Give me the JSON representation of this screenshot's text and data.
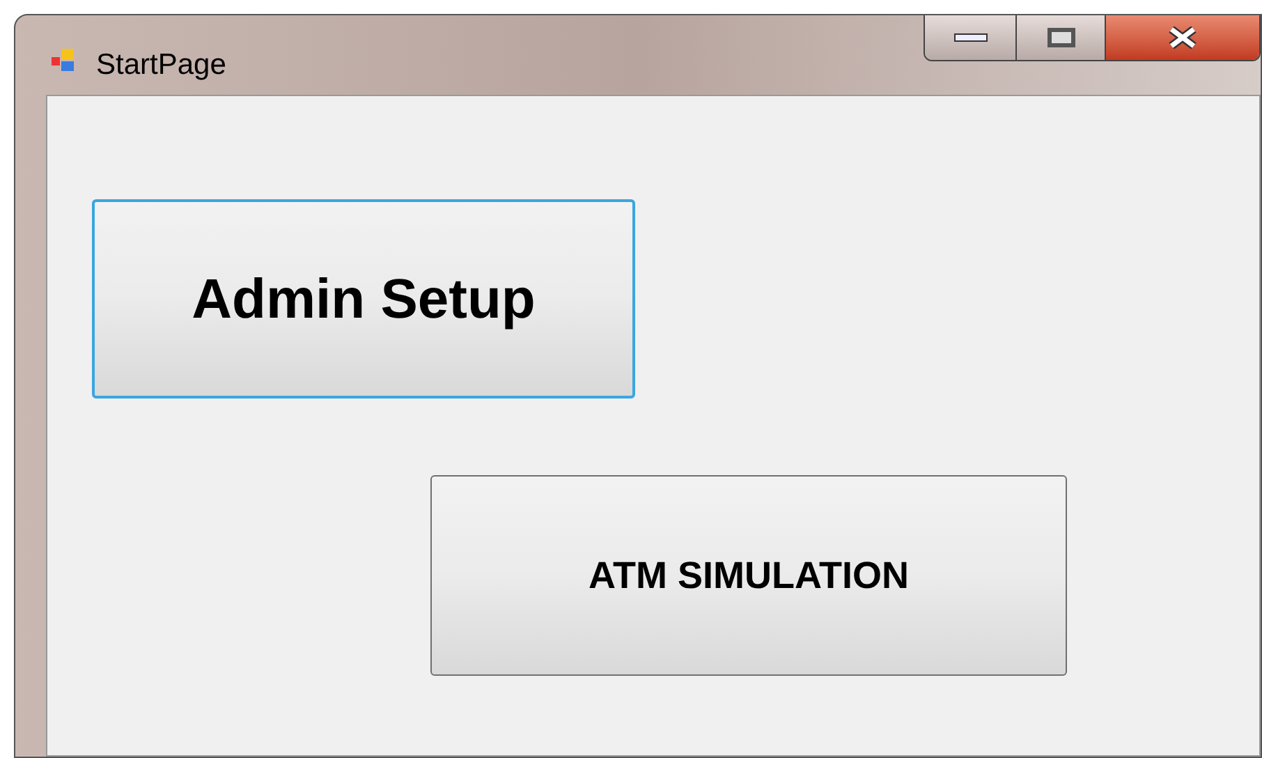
{
  "window": {
    "title": "StartPage"
  },
  "buttons": [
    {
      "label": "Admin Setup",
      "kind": "large",
      "focused": true
    },
    {
      "label": "ATM SIMULATION",
      "kind": "medium",
      "focused": false
    }
  ]
}
